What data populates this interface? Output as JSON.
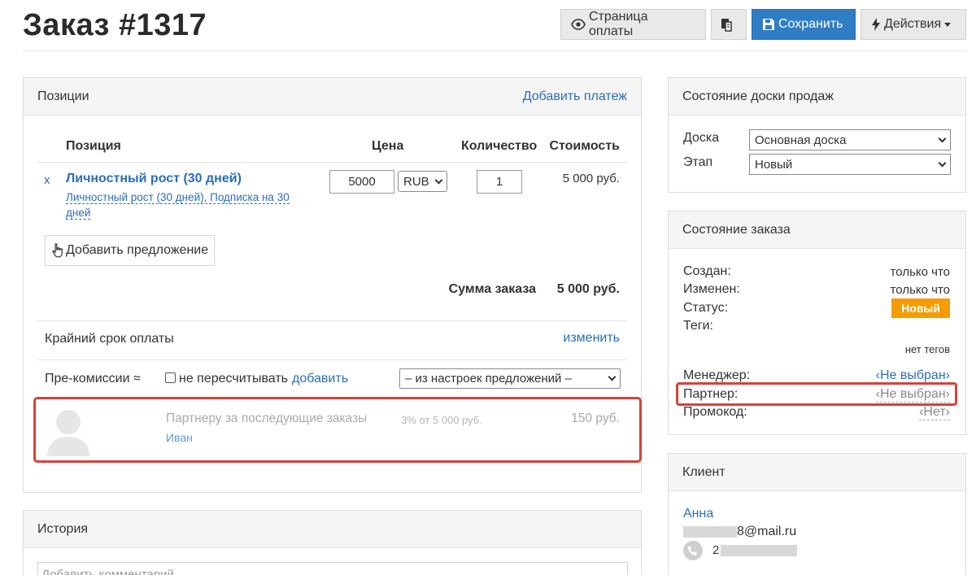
{
  "page": {
    "title": "Заказ #1317"
  },
  "toolbar": {
    "payment_page": "Страница оплаты",
    "save": "Сохранить",
    "actions": "Действия"
  },
  "positions": {
    "header": "Позиции",
    "add_payment": "Добавить платеж",
    "columns": {
      "position": "Позиция",
      "price": "Цена",
      "quantity": "Количество",
      "cost": "Стоимость"
    },
    "item": {
      "remove": "x",
      "title": "Личностный рост (30 дней)",
      "subtitle": "Личностный рост (30 дней), Подписка на 30 дней",
      "price": "5000",
      "currency": "RUB",
      "quantity": "1",
      "cost": "5 000 руб."
    },
    "add_offer": "Добавить предложение",
    "sum_label": "Сумма заказа",
    "sum_value": "5 000 руб.",
    "deadline_label": "Крайний срок оплаты",
    "deadline_link": "изменить",
    "precommission_label": "Пре-комиссии ≈",
    "no_recalc_label": "не пересчитывать",
    "add_link": "добавить",
    "precommission_select": "– из настроек предложений –",
    "partner_row": {
      "title": "Партнеру за последующие заказы",
      "name": "Иван",
      "rate": "3% от 5 000 руб.",
      "amount": "150 руб."
    }
  },
  "history": {
    "header": "История",
    "comment_placeholder": "Добавить комментарий"
  },
  "board": {
    "header": "Состояние доски продаж",
    "board_label": "Доска",
    "board_value": "Основная доска",
    "stage_label": "Этап",
    "stage_value": "Новый"
  },
  "order_state": {
    "header": "Состояние заказа",
    "created_label": "Создан:",
    "created_value": "только что",
    "modified_label": "Изменен:",
    "modified_value": "только что",
    "status_label": "Статус:",
    "status_value": "Новый",
    "tags_label": "Теги:",
    "tags_value": "нет тегов",
    "manager_label": "Менеджер:",
    "manager_value": "‹Не выбран›",
    "partner_label": "Партнер:",
    "partner_value": "‹Не выбран›",
    "promo_label": "Промокод:",
    "promo_value": "‹Нет›"
  },
  "client": {
    "header": "Клиент",
    "name": "Анна",
    "email_visible": "8@mail.ru",
    "phone_visible": "2"
  },
  "colors": {
    "accent": "#2f7dc4",
    "status_badge": "#f59c00",
    "highlight": "#d9413b",
    "link": "#2a6ebb"
  }
}
